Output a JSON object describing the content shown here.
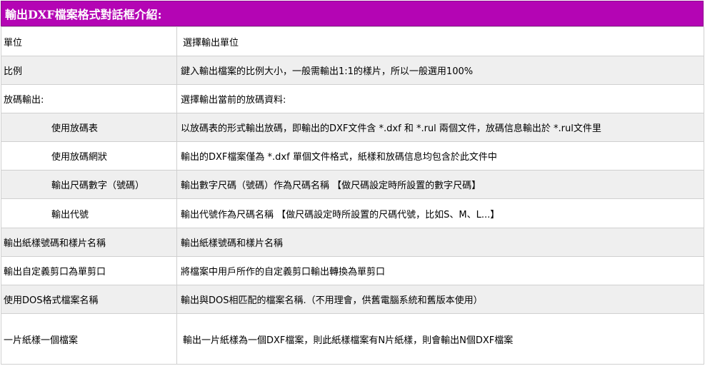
{
  "title": "輸出DXF檔案格式對話框介紹:",
  "rows": [
    {
      "label": "單位",
      "desc": "選擇輸出單位",
      "indent": false,
      "alt": false,
      "h": 41
    },
    {
      "label": "比例",
      "desc": "鍵入輸出檔案的比例大小，一般需輸出1:1的樣片，所以一般選用100%",
      "indent": false,
      "alt": true,
      "h": 40
    },
    {
      "label": "放碼輸出:",
      "desc": "選擇輸出當前的放碼資料:",
      "indent": false,
      "alt": false,
      "h": 40
    },
    {
      "label": "使用放碼表",
      "desc": "以放碼表的形式輸出放碼，即輸出的DXF文件含 *.dxf 和 *.rul 兩個文件，放碼信息輸出於 *.rul文件里",
      "indent": true,
      "alt": true,
      "h": 40
    },
    {
      "label": "使用放碼網狀",
      "desc": "輸出的DXF檔案僅為 *.dxf 單個文件格式，紙樣和放碼信息均包含於此文件中",
      "indent": true,
      "alt": false,
      "h": 40
    },
    {
      "label": "輸出尺碼數字（號碼）",
      "desc": "輸出數字尺碼（號碼）作為尺碼名稱 【做尺碼設定時所設置的數字尺碼】",
      "indent": true,
      "alt": true,
      "h": 40
    },
    {
      "label": "輸出代號",
      "desc": "輸出代號作為尺碼名稱 【做尺碼設定時所設置的尺碼代號，比如S、M、L...】",
      "indent": true,
      "alt": false,
      "h": 41
    },
    {
      "label": "輸出紙樣號碼和樣片名稱",
      "desc": "輸出紙樣號碼和樣片名稱",
      "indent": false,
      "alt": true,
      "h": 40
    },
    {
      "label": "輸出自定義剪口為單剪口",
      "desc": "將檔案中用戶所作的自定義剪口輸出轉換為單剪口",
      "indent": false,
      "alt": false,
      "h": 40
    },
    {
      "label": "使用DOS格式檔案名稱",
      "desc": "輸出與DOS相匹配的檔案名稱.（不用理會，供舊電腦系統和舊版本使用）",
      "indent": false,
      "alt": true,
      "h": 40
    },
    {
      "label": "一片紙樣一個檔案",
      "desc": "輸出一片紙樣為一個DXF檔案，則此紙樣檔案有N片紙樣，則會輸出N個DXF檔案",
      "indent": false,
      "alt": false,
      "h": 71
    }
  ]
}
